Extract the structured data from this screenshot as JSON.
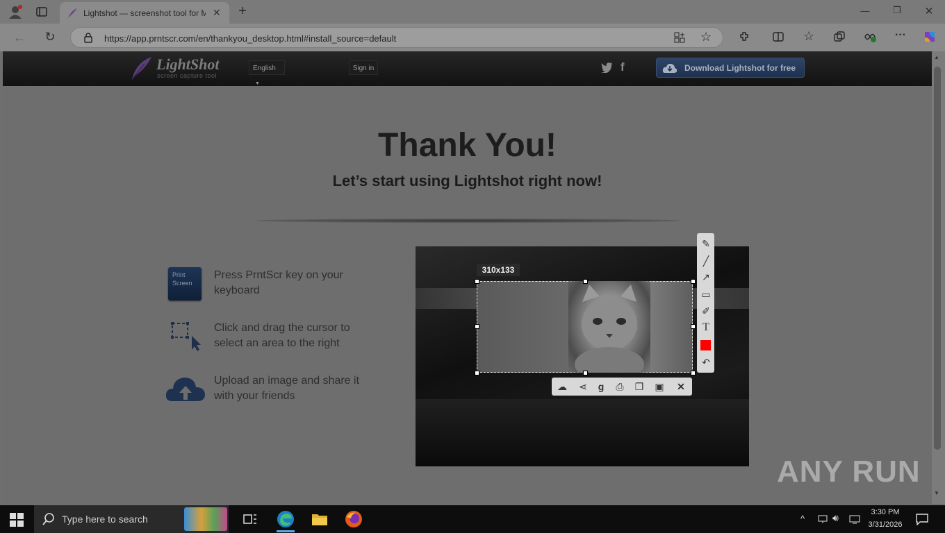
{
  "browser": {
    "tab_title": "Lightshot — screenshot tool for M",
    "url": "https://app.prntscr.com/en/thankyou_desktop.html#install_source=default",
    "new_tab_symbol": "+",
    "window_controls": [
      "—",
      "❐",
      "✕"
    ]
  },
  "site": {
    "logo_text": "LightShot",
    "logo_subtitle": "screen capture tool",
    "language": "English",
    "signin": "Sign in",
    "download_button": "Download Lightshot for free"
  },
  "main": {
    "title": "Thank You!",
    "subtitle": "Let’s start using Lightshot right now!",
    "key_icon_line1": "Print",
    "key_icon_line2": "Screen",
    "steps": [
      {
        "text": "Press PrntScr key on your keyboard"
      },
      {
        "text": "Click and drag the cursor to select an area to the right"
      },
      {
        "text": "Upload an image and share it with your friends"
      }
    ],
    "selection_size": "310x133"
  },
  "taskbar": {
    "search_placeholder": "Type here to search",
    "time": "3:30 PM",
    "date": "3/31/2026"
  },
  "watermark": "ANY RUN",
  "colors": {
    "download_button": "#1e3150",
    "color_swatch": "#ff0000",
    "taskbar": "#0d0d0d"
  }
}
